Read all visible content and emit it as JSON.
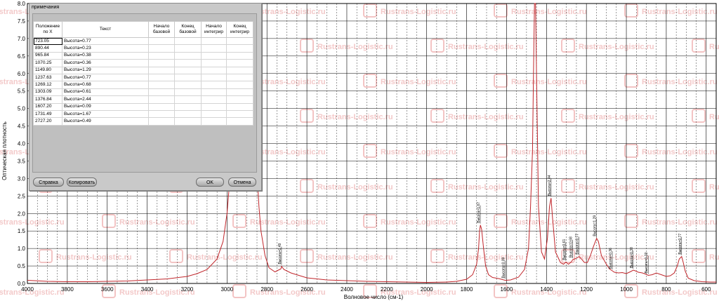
{
  "chart_data": {
    "type": "line",
    "ylabel": "Оптическая плотность",
    "xlabel": "Волновое число (см-1)",
    "xlim": [
      4000,
      550
    ],
    "ylim": [
      0,
      8.0
    ],
    "x_ticks": [
      4000,
      3800,
      3600,
      3400,
      3200,
      3000,
      2800,
      2600,
      2400,
      2200,
      2000,
      1800,
      1600,
      1400,
      1200,
      1000,
      800,
      600
    ],
    "y_ticks": [
      "0.0",
      "0.5",
      "1.0",
      "1.5",
      "2.0",
      "2.5",
      "3.0",
      "3.5",
      "4.0",
      "4.5",
      "5.0",
      "5.5",
      "6.0",
      "6.5",
      "7.0",
      "7.5",
      "8.0"
    ],
    "line_color": "#c0262b",
    "series": [
      {
        "points": [
          [
            4000,
            0.09
          ],
          [
            3900,
            0.06
          ],
          [
            3800,
            0.05
          ],
          [
            3700,
            0.05
          ],
          [
            3600,
            0.06
          ],
          [
            3500,
            0.07
          ],
          [
            3400,
            0.1
          ],
          [
            3300,
            0.13
          ],
          [
            3200,
            0.2
          ],
          [
            3150,
            0.28
          ],
          [
            3100,
            0.4
          ],
          [
            3050,
            0.7
          ],
          [
            3020,
            1.2
          ],
          [
            3000,
            2.0
          ],
          [
            2990,
            2.7
          ],
          [
            2975,
            3.8
          ],
          [
            2960,
            5.0
          ],
          [
            2950,
            6.8
          ],
          [
            2940,
            8.0
          ],
          [
            2880,
            8.0
          ],
          [
            2860,
            5.0
          ],
          [
            2850,
            3.2
          ],
          [
            2840,
            2.2
          ],
          [
            2830,
            1.5
          ],
          [
            2810,
            0.8
          ],
          [
            2790,
            0.45
          ],
          [
            2760,
            0.33
          ],
          [
            2730,
            0.42
          ],
          [
            2727,
            0.49
          ],
          [
            2715,
            0.4
          ],
          [
            2680,
            0.3
          ],
          [
            2600,
            0.16
          ],
          [
            2500,
            0.1
          ],
          [
            2400,
            0.08
          ],
          [
            2300,
            0.06
          ],
          [
            2200,
            0.05
          ],
          [
            2100,
            0.04
          ],
          [
            2000,
            0.03
          ],
          [
            1900,
            0.04
          ],
          [
            1850,
            0.06
          ],
          [
            1800,
            0.12
          ],
          [
            1770,
            0.25
          ],
          [
            1750,
            0.55
          ],
          [
            1740,
            1.0
          ],
          [
            1735,
            1.5
          ],
          [
            1731,
            1.67
          ],
          [
            1725,
            1.55
          ],
          [
            1715,
            1.0
          ],
          [
            1705,
            0.5
          ],
          [
            1690,
            0.25
          ],
          [
            1670,
            0.17
          ],
          [
            1640,
            0.14
          ],
          [
            1607,
            0.09
          ],
          [
            1580,
            0.1
          ],
          [
            1540,
            0.18
          ],
          [
            1510,
            0.4
          ],
          [
            1490,
            1.0
          ],
          [
            1480,
            2.2
          ],
          [
            1470,
            3.8
          ],
          [
            1465,
            6.0
          ],
          [
            1460,
            8.0
          ],
          [
            1455,
            8.0
          ],
          [
            1450,
            6.0
          ],
          [
            1440,
            2.2
          ],
          [
            1425,
            0.9
          ],
          [
            1410,
            0.7
          ],
          [
            1395,
            1.3
          ],
          [
            1385,
            2.2
          ],
          [
            1377,
            2.44
          ],
          [
            1370,
            1.9
          ],
          [
            1355,
            0.9
          ],
          [
            1330,
            0.6
          ],
          [
            1315,
            0.55
          ],
          [
            1303,
            0.61
          ],
          [
            1290,
            0.55
          ],
          [
            1275,
            0.62
          ],
          [
            1269,
            0.68
          ],
          [
            1260,
            0.7
          ],
          [
            1250,
            0.72
          ],
          [
            1237,
            0.77
          ],
          [
            1225,
            0.7
          ],
          [
            1210,
            0.6
          ],
          [
            1195,
            0.6
          ],
          [
            1180,
            0.8
          ],
          [
            1165,
            1.05
          ],
          [
            1149,
            1.29
          ],
          [
            1140,
            1.2
          ],
          [
            1125,
            0.8
          ],
          [
            1100,
            0.55
          ],
          [
            1085,
            0.42
          ],
          [
            1070,
            0.36
          ],
          [
            1060,
            0.32
          ],
          [
            1040,
            0.3
          ],
          [
            1020,
            0.31
          ],
          [
            1000,
            0.28
          ],
          [
            985,
            0.32
          ],
          [
            965,
            0.38
          ],
          [
            955,
            0.36
          ],
          [
            940,
            0.32
          ],
          [
            920,
            0.3
          ],
          [
            905,
            0.27
          ],
          [
            890,
            0.23
          ],
          [
            870,
            0.25
          ],
          [
            850,
            0.3
          ],
          [
            820,
            0.24
          ],
          [
            800,
            0.2
          ],
          [
            780,
            0.22
          ],
          [
            760,
            0.3
          ],
          [
            745,
            0.5
          ],
          [
            735,
            0.7
          ],
          [
            723,
            0.77
          ],
          [
            715,
            0.6
          ],
          [
            705,
            0.35
          ],
          [
            690,
            0.15
          ],
          [
            660,
            0.08
          ],
          [
            620,
            0.05
          ],
          [
            580,
            0.04
          ],
          [
            550,
            0.04
          ]
        ]
      }
    ],
    "peak_labels": [
      {
        "x": 2727.2,
        "y": 0.49,
        "text": "Высота=0.49"
      },
      {
        "x": 1731.49,
        "y": 1.67,
        "text": "Высота=1.67"
      },
      {
        "x": 1607.2,
        "y": 0.09,
        "text": "Высота=0.09"
      },
      {
        "x": 1376.84,
        "y": 2.44,
        "text": "Высота=2.44"
      },
      {
        "x": 1303.09,
        "y": 0.61,
        "text": "Высота=0.61"
      },
      {
        "x": 1269.12,
        "y": 0.68,
        "text": "Высота=0.68"
      },
      {
        "x": 1237.63,
        "y": 0.77,
        "text": "Высота=0.77"
      },
      {
        "x": 1149.8,
        "y": 1.29,
        "text": "Высота=1.29"
      },
      {
        "x": 1070.25,
        "y": 0.36,
        "text": "Высота=0.36"
      },
      {
        "x": 965.84,
        "y": 0.38,
        "text": "Высота=0.38"
      },
      {
        "x": 890.44,
        "y": 0.23,
        "text": "Высота=0.23"
      },
      {
        "x": 723.05,
        "y": 0.77,
        "text": "Высота=0.77"
      }
    ]
  },
  "watermark": {
    "text": "Rustrans-Logistic.ru"
  },
  "dialog": {
    "title": "примечания",
    "headers": [
      "Положение по X",
      "Текст",
      "Начало базовой",
      "Конец базовой",
      "Начало интегрир",
      "Конец интегрир"
    ],
    "rows": [
      [
        "723.05",
        "Высота=0.77"
      ],
      [
        "890.44",
        "Высота=0.23"
      ],
      [
        "965.84",
        "Высота=0.38"
      ],
      [
        "1070.25",
        "Высота=0.36"
      ],
      [
        "1149.80",
        "Высота=1.29"
      ],
      [
        "1237.63",
        "Высота=0.77"
      ],
      [
        "1269.12",
        "Высота=0.68"
      ],
      [
        "1303.09",
        "Высота=0.61"
      ],
      [
        "1376.84",
        "Высота=2.44"
      ],
      [
        "1607.20",
        "Высота=0.09"
      ],
      [
        "1731.49",
        "Высота=1.67"
      ],
      [
        "2727.20",
        "Высота=0.49"
      ]
    ],
    "buttons": {
      "help": "Справка",
      "copy": "Копировать",
      "ok": "OK",
      "cancel": "Отмена"
    }
  }
}
